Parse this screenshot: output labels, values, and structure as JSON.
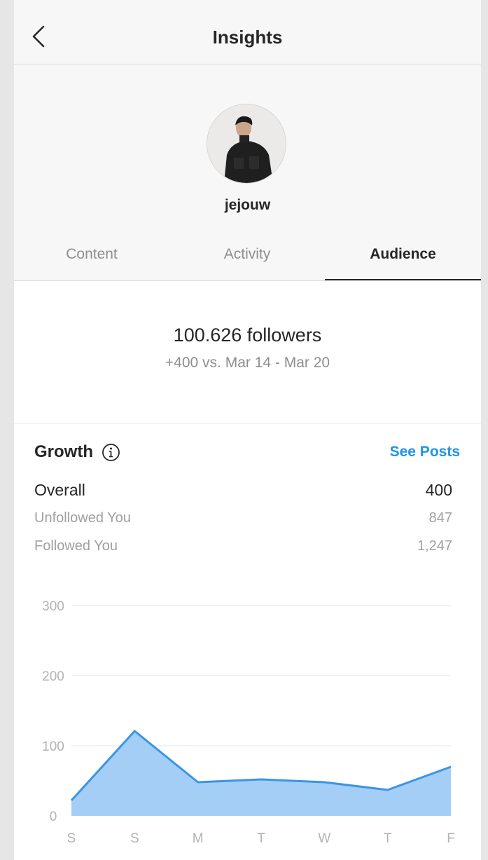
{
  "nav": {
    "title": "Insights",
    "back_icon": "chevron-left-icon"
  },
  "profile": {
    "username": "jejouw"
  },
  "tabs": [
    {
      "label": "Content",
      "active": false
    },
    {
      "label": "Activity",
      "active": false
    },
    {
      "label": "Audience",
      "active": true
    }
  ],
  "followers": {
    "count_text": "100.626 followers",
    "compare_text": "+400 vs. Mar 14 - Mar 20"
  },
  "growth": {
    "title": "Growth",
    "info_icon": "info-icon",
    "see_posts_label": "See Posts",
    "overall": {
      "label": "Overall",
      "value": "400"
    },
    "unfollowed": {
      "label": "Unfollowed You",
      "value": "847"
    },
    "followed": {
      "label": "Followed You",
      "value": "1,247"
    }
  },
  "colors": {
    "accent": "#1f95e8",
    "area_fill": "#a4cef5",
    "area_line": "#3a95e6"
  },
  "chart_data": {
    "type": "area",
    "categories": [
      "S",
      "S",
      "M",
      "T",
      "W",
      "T",
      "F"
    ],
    "values": [
      22,
      121,
      48,
      52,
      48,
      37,
      70
    ],
    "ylim": [
      0,
      300
    ],
    "yticks": [
      0,
      100,
      200,
      300
    ],
    "grid": true
  }
}
